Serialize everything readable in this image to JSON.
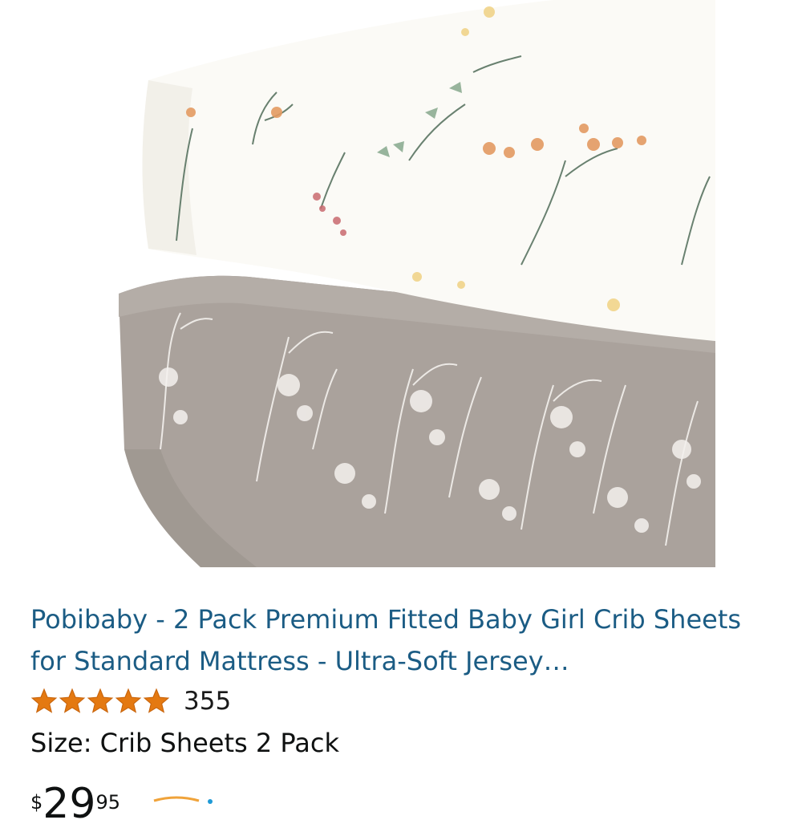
{
  "product": {
    "title": "Pobibaby - 2 Pack Premium Fitted Baby Girl Crib Sheets for Standard Mattress - Ultra-Soft Jersey…",
    "rating": 5,
    "rating_max": 5,
    "review_count": "355",
    "size_line": "Size: Crib Sheets 2 Pack",
    "price": {
      "currency_symbol": "$",
      "whole": "29",
      "fraction": "95"
    }
  },
  "colors": {
    "title_link": "#1b5c84",
    "star": "#e47911",
    "sheet_top": "#fbfaf6",
    "sheet_bottom": "#aba39d",
    "prime_blue": "#1f9ad6"
  }
}
